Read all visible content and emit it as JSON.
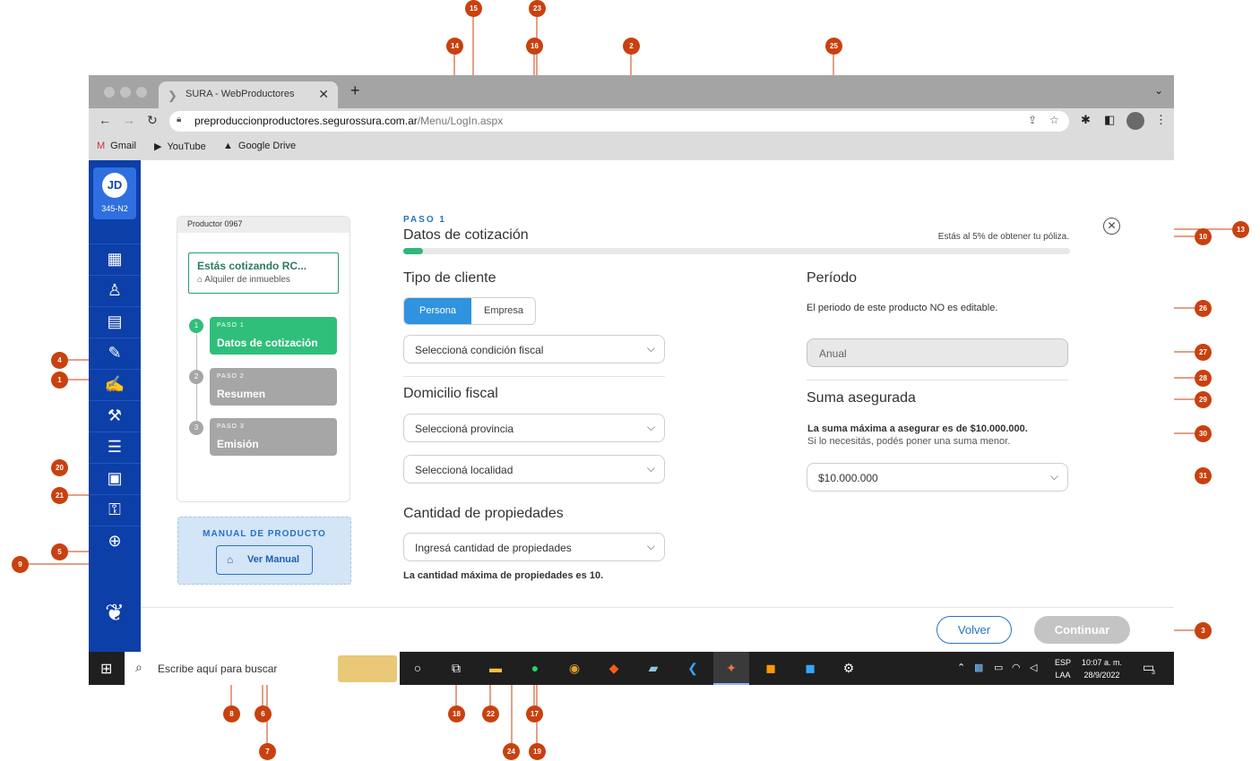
{
  "browser": {
    "tab_title": "SURA - WebProductores",
    "url_host": "preproduccionproductores.segurossura.com.ar",
    "url_path": "/Menu/LogIn.aspx",
    "bookmarks": [
      "Gmail",
      "YouTube",
      "Google Drive"
    ]
  },
  "user": {
    "initials": "JD",
    "code": "345-N2"
  },
  "stepper": {
    "header": "Productor 0967",
    "quote_title": "Estás cotizando RC...",
    "quote_subtitle": "Alquiler de inmuebles",
    "steps": [
      {
        "number": "1",
        "kicker": "PASO 1",
        "title": "Datos de cotización",
        "color": "#2fbf7b"
      },
      {
        "number": "2",
        "kicker": "PASO 2",
        "title": "Resumen",
        "color": "#a6a6a6"
      },
      {
        "number": "3",
        "kicker": "PASO 3",
        "title": "Emisión",
        "color": "#a6a6a6"
      }
    ]
  },
  "manual": {
    "title": "MANUAL DE PRODUCTO",
    "button": "Ver Manual"
  },
  "form": {
    "kicker": "PASO 1",
    "title": "Datos de cotización",
    "progress_text": "Estás al 5% de obtener tu póliza.",
    "progress": 0.03,
    "tipo_cliente": {
      "heading": "Tipo de cliente",
      "selected": "Persona",
      "other": "Empresa"
    },
    "condicion_fiscal": "Seleccioná condición fiscal",
    "domicilio": {
      "heading": "Domicilio fiscal",
      "provincia": "Seleccioná provincia",
      "localidad": "Seleccioná localidad"
    },
    "propiedades": {
      "heading": "Cantidad de propiedades",
      "placeholder": "Ingresá cantidad de propiedades",
      "hint": "La cantidad máxima de propiedades es 10."
    },
    "periodo": {
      "heading": "Período",
      "hint": "El periodo de este producto NO es editable.",
      "value": "Anual"
    },
    "suma": {
      "heading": "Suma asegurada",
      "hint_bold": "La suma máxima a asegurar es de $10.000.000.",
      "hint": "Si lo necesitás, podés poner una suma menor.",
      "value": "$10.000.000"
    },
    "back_button": "Volver",
    "continue_button": "Continuar"
  },
  "taskbar": {
    "search_placeholder": "Escribe aquí para buscar",
    "lang_top": "ESP",
    "lang_bottom": "LAA",
    "time": "10:07 a. m.",
    "date": "28/9/2022",
    "notifications": "3"
  },
  "colors": {
    "marker": "#c8410f",
    "brand_blue": "#0d3fa8",
    "accent_green": "#2fbf7b",
    "link_blue": "#2672c4"
  },
  "markers": [
    {
      "n": "1"
    },
    {
      "n": "2"
    },
    {
      "n": "3"
    },
    {
      "n": "4"
    },
    {
      "n": "5"
    },
    {
      "n": "6"
    },
    {
      "n": "7"
    },
    {
      "n": "8"
    },
    {
      "n": "9"
    },
    {
      "n": "10"
    },
    {
      "n": "13"
    },
    {
      "n": "14"
    },
    {
      "n": "15"
    },
    {
      "n": "16"
    },
    {
      "n": "17"
    },
    {
      "n": "18"
    },
    {
      "n": "19"
    },
    {
      "n": "20"
    },
    {
      "n": "21"
    },
    {
      "n": "22"
    },
    {
      "n": "23"
    },
    {
      "n": "24"
    },
    {
      "n": "25"
    },
    {
      "n": "26"
    },
    {
      "n": "27"
    },
    {
      "n": "28"
    },
    {
      "n": "29"
    },
    {
      "n": "30"
    },
    {
      "n": "31"
    }
  ]
}
